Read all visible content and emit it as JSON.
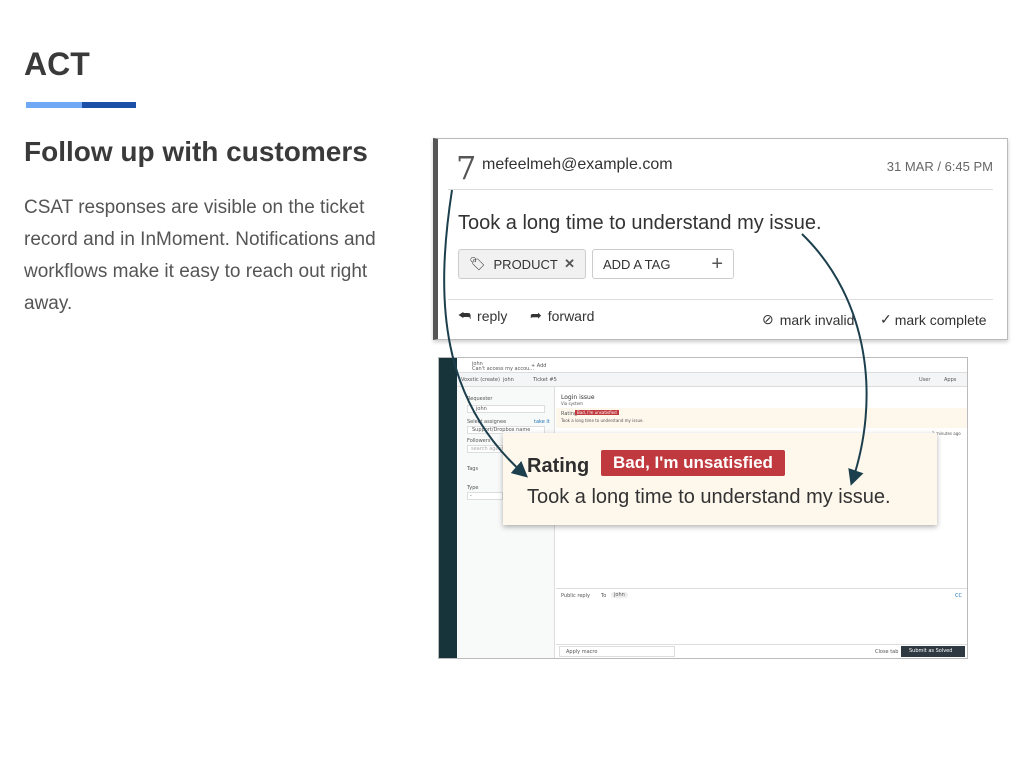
{
  "slide": {
    "title": "ACT",
    "heading": "Follow up with customers",
    "description": "CSAT responses are visible on the ticket record and in InMoment. Notifications and workflows make it easy to reach out right away."
  },
  "card": {
    "score": "7",
    "email": "mefeelmeh@example.com",
    "date": "31 MAR / 6:45 PM",
    "message": "Took a long time to understand my issue.",
    "tag": "PRODUCT",
    "add_tag": "ADD A TAG",
    "reply": "reply",
    "forward": "forward",
    "mark_invalid": "mark invalid",
    "mark_complete": "mark complete"
  },
  "screenshot": {
    "tab_user": "john",
    "tab_subject": "Can't access my accou...",
    "add": "+ Add",
    "breadcrumb": [
      "Voxstic (create)",
      "john",
      "Ticket #5"
    ],
    "user_btn": "User",
    "apps_btn": "Apps",
    "requester_label": "Requester",
    "requester": "john",
    "assignee_label": "Select assignee",
    "take_it": "take it",
    "assignee": "Support/Dropbox name",
    "followers_label": "Followers",
    "followers_placeholder": "search agents",
    "tags_label": "Tags",
    "type_label": "Type",
    "type_value": "-",
    "ticket_title": "Login issue",
    "via": "Via system",
    "rating_label": "Rating",
    "rating_badge": "Bad, I'm unsatisfied",
    "rating_comment": "Took a long time to understand my issue.",
    "time_ago": "2 minutes ago",
    "public_reply": "Public reply",
    "to": "To",
    "to_user": "john",
    "cc": "CC",
    "apply_macro": "Apply macro",
    "close_tab": "Close tab",
    "submit": "Submit as Solved"
  },
  "popup": {
    "rating_label": "Rating",
    "badge": "Bad, I'm unsatisfied",
    "comment": "Took a long time to understand my issue."
  },
  "colors": {
    "accent_light": "#6fa8f5",
    "accent_dark": "#1b4fa8",
    "badge": "#c0393f",
    "arrow": "#1c3f4d",
    "sidebar": "#17343a"
  }
}
